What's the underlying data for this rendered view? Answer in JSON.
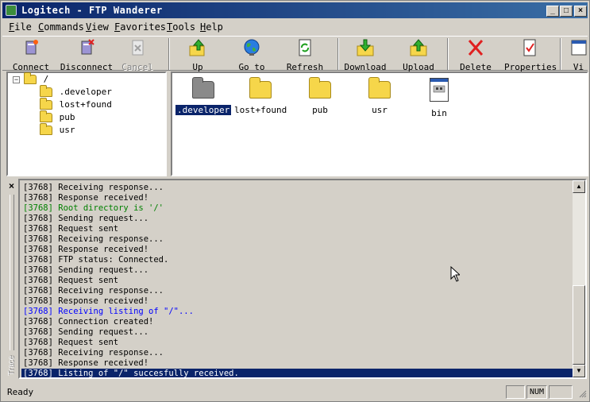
{
  "window": {
    "title": "Logitech - FTP Wanderer"
  },
  "menu": [
    {
      "label": "File",
      "ul": "F",
      "rest": "ile"
    },
    {
      "label": "Commands",
      "ul": "C",
      "rest": "ommands"
    },
    {
      "label": "View",
      "ul": "V",
      "rest": "iew"
    },
    {
      "label": "Favorites",
      "ul": "F",
      "rest": "avorites"
    },
    {
      "label": "Tools",
      "ul": "T",
      "rest": "ools"
    },
    {
      "label": "Help",
      "ul": "H",
      "rest": "elp"
    }
  ],
  "toolbar": {
    "connect": "Connect",
    "disconnect": "Disconnect",
    "cancel": "Cancel",
    "up": "Up",
    "goto": "Go to",
    "refresh": "Refresh",
    "download": "Download",
    "upload": "Upload",
    "delete": "Delete",
    "properties": "Properties",
    "view": "Vi"
  },
  "tree": {
    "root": "/",
    "children": [
      ".developer",
      "lost+found",
      "pub",
      "usr"
    ]
  },
  "files": [
    {
      "name": ".developer",
      "kind": "hidden-folder",
      "selected": true
    },
    {
      "name": "lost+found",
      "kind": "folder"
    },
    {
      "name": "pub",
      "kind": "folder"
    },
    {
      "name": "usr",
      "kind": "folder"
    },
    {
      "name": "bin",
      "kind": "file"
    }
  ],
  "trace": {
    "label": "Trace",
    "lines": [
      {
        "text": "[3768] Receiving response...",
        "color": "normal"
      },
      {
        "text": "[3768] Response received!",
        "color": "normal"
      },
      {
        "text": "[3768] Root directory is '/'",
        "color": "green"
      },
      {
        "text": "[3768] Sending request...",
        "color": "normal"
      },
      {
        "text": "[3768] Request sent",
        "color": "normal"
      },
      {
        "text": "[3768] Receiving response...",
        "color": "normal"
      },
      {
        "text": "[3768] Response received!",
        "color": "normal"
      },
      {
        "text": "[3768] FTP status: Connected.",
        "color": "normal"
      },
      {
        "text": "[3768] Sending request...",
        "color": "normal"
      },
      {
        "text": "[3768] Request sent",
        "color": "normal"
      },
      {
        "text": "[3768] Receiving response...",
        "color": "normal"
      },
      {
        "text": "[3768] Response received!",
        "color": "normal"
      },
      {
        "text": "[3768] Receiving listing of \"/\"...",
        "color": "blue"
      },
      {
        "text": "[3768] Connection created!",
        "color": "normal"
      },
      {
        "text": "[3768] Sending request...",
        "color": "normal"
      },
      {
        "text": "[3768] Request sent",
        "color": "normal"
      },
      {
        "text": "[3768] Receiving response...",
        "color": "normal"
      },
      {
        "text": "[3768] Response received!",
        "color": "normal"
      },
      {
        "text": "[3768] Listing of \"/\" succesfully received.",
        "color": "selected"
      }
    ]
  },
  "status": {
    "text": "Ready",
    "num": "NUM"
  },
  "colors": {
    "title_start": "#0a246a",
    "title_end": "#3a6ea5",
    "selection": "#0a246a",
    "log_green": "#008000",
    "log_blue": "#0000ff",
    "folder": "#f6d64a"
  }
}
